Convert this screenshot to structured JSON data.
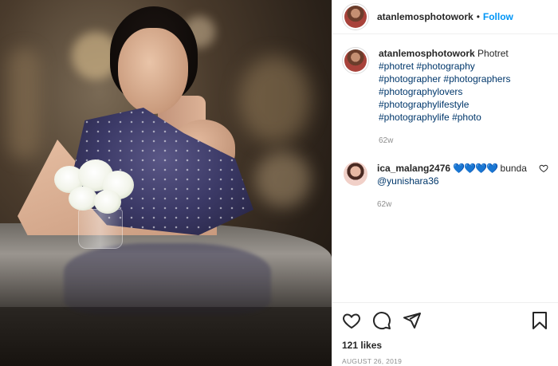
{
  "header": {
    "username": "atanlemosphotowork",
    "separator": "•",
    "follow_label": "Follow"
  },
  "caption": {
    "username": "atanlemosphotowork",
    "text": "Photret",
    "hashtags_line1": "#photret #photography",
    "hashtags_line2": "#photographer #photographers",
    "hashtags_line3": "#photographylovers",
    "hashtags_line4": "#photographylifestyle",
    "hashtags_line5": "#photographylife #photo",
    "time": "62w"
  },
  "comment": {
    "username": "ica_malang2476",
    "hearts": "💙💙💙💙",
    "text": "bunda",
    "mention": "@yunishara36",
    "time": "62w"
  },
  "footer": {
    "likes": "121 likes",
    "date": "AUGUST 26, 2019"
  },
  "icons": [
    "heart-icon",
    "comment-icon",
    "share-icon",
    "bookmark-icon"
  ],
  "colors": {
    "follow": "#0095f6",
    "hashtag": "#00376b",
    "muted": "#8e8e8e",
    "heart_emoji": "#1bb3b1"
  }
}
